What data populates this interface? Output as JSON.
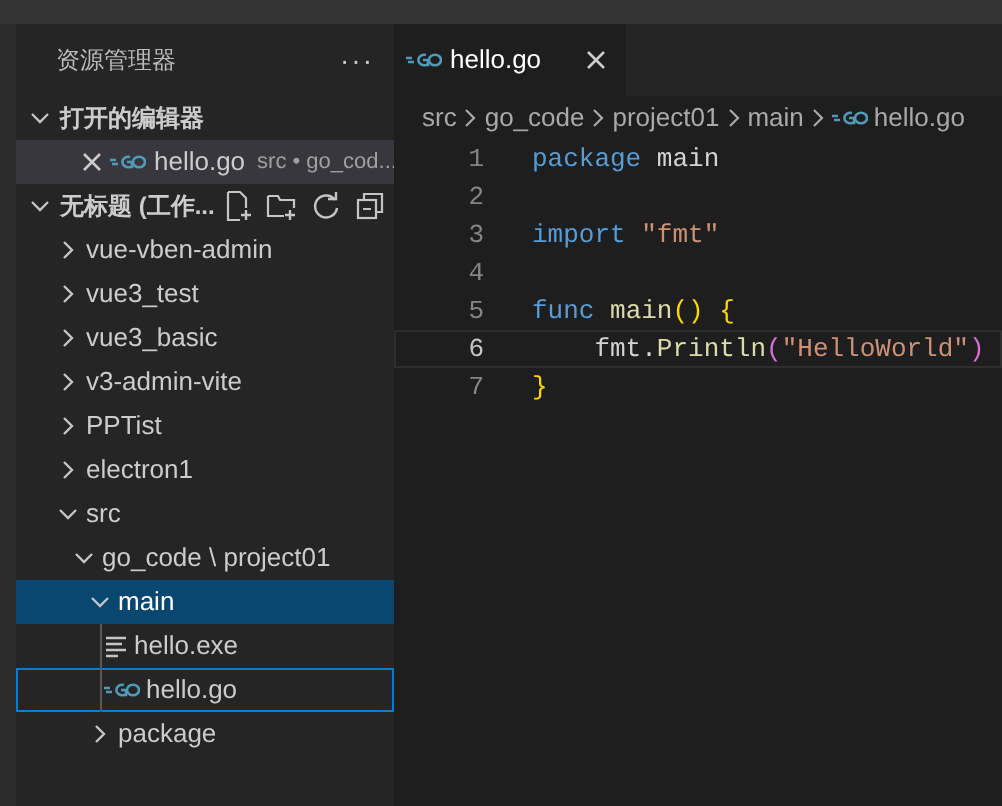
{
  "sidebar": {
    "title": "资源管理器",
    "more": "···",
    "open_editors": {
      "label": "打开的编辑器",
      "expanded": true,
      "items": [
        {
          "name": "hello.go",
          "path": "src • go_cod...",
          "kind": "go",
          "selected": true
        }
      ]
    },
    "workspace": {
      "label": "无标题 (工作...",
      "expanded": true,
      "tree": [
        {
          "name": "vue-vben-admin",
          "kind": "folder",
          "expanded": false,
          "selected": false,
          "focused": false
        },
        {
          "name": "vue3_test",
          "kind": "folder",
          "expanded": false,
          "selected": false,
          "focused": false
        },
        {
          "name": "vue3_basic",
          "kind": "folder",
          "expanded": false,
          "selected": false,
          "focused": false
        },
        {
          "name": "v3-admin-vite",
          "kind": "folder",
          "expanded": false,
          "selected": false,
          "focused": false
        },
        {
          "name": "PPTist",
          "kind": "folder",
          "expanded": false,
          "selected": false,
          "focused": false
        },
        {
          "name": "electron1",
          "kind": "folder",
          "expanded": false,
          "selected": false,
          "focused": false
        },
        {
          "name": "src",
          "kind": "folder",
          "expanded": true,
          "selected": false,
          "focused": false,
          "children": [
            {
              "name": "go_code \\ project01",
              "kind": "folder",
              "expanded": true,
              "selected": false,
              "focused": false,
              "children": [
                {
                  "name": "main",
                  "kind": "folder",
                  "expanded": true,
                  "selected": true,
                  "focused": false,
                  "children": [
                    {
                      "name": "hello.exe",
                      "kind": "file",
                      "selected": false,
                      "focused": false
                    },
                    {
                      "name": "hello.go",
                      "kind": "go",
                      "selected": false,
                      "focused": true
                    }
                  ]
                },
                {
                  "name": "package",
                  "kind": "folder",
                  "expanded": false,
                  "selected": false,
                  "focused": false
                }
              ]
            }
          ]
        }
      ]
    }
  },
  "editor": {
    "tabs": [
      {
        "label": "hello.go",
        "kind": "go",
        "selected": true
      }
    ],
    "breadcrumb": [
      {
        "text": "src",
        "kind": "folder"
      },
      {
        "text": "go_code",
        "kind": "folder"
      },
      {
        "text": "project01",
        "kind": "folder"
      },
      {
        "text": "main",
        "kind": "folder"
      },
      {
        "text": "hello.go",
        "kind": "go"
      }
    ],
    "lines": [
      {
        "number": "1",
        "current": false,
        "tokens": [
          {
            "kind": "keyword",
            "text": "package"
          },
          {
            "kind": "plain",
            "text": " main"
          }
        ]
      },
      {
        "number": "2",
        "current": false
      },
      {
        "number": "3",
        "current": false,
        "tokens": [
          {
            "kind": "keyword",
            "text": "import"
          },
          {
            "kind": "string",
            "text": " \"fmt\""
          }
        ]
      },
      {
        "number": "4",
        "current": false
      },
      {
        "number": "5",
        "current": false,
        "tokens": [
          {
            "kind": "keyword",
            "text": "func"
          },
          {
            "kind": "function",
            "text": " main"
          },
          {
            "kind": "bracket1",
            "text": "() {"
          }
        ]
      },
      {
        "number": "6",
        "current": true,
        "tokens": [
          {
            "kind": "plain",
            "text": "    fmt."
          },
          {
            "kind": "function",
            "text": "Println"
          },
          {
            "kind": "bracket2",
            "text": "("
          },
          {
            "kind": "string",
            "text": "\"HelloWorld\""
          },
          {
            "kind": "bracket2",
            "text": ")"
          }
        ]
      },
      {
        "number": "7",
        "current": false,
        "tokens": [
          {
            "kind": "bracket1",
            "text": "}"
          }
        ]
      }
    ]
  }
}
